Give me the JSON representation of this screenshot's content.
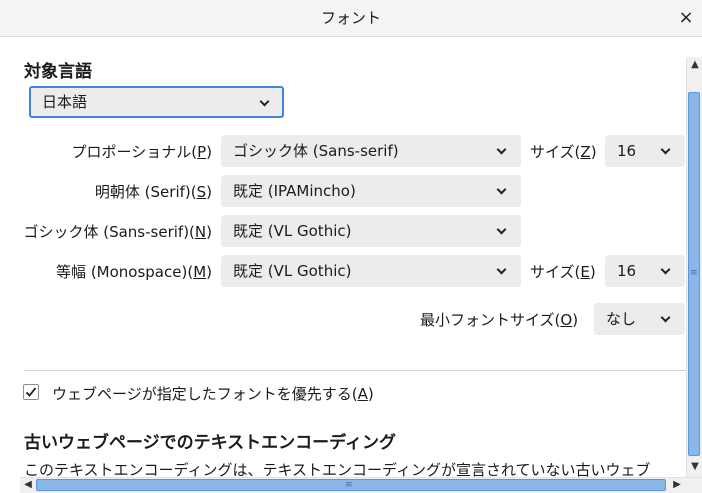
{
  "window": {
    "title": "フォント",
    "close_glyph": "×"
  },
  "language": {
    "heading": "対象言語",
    "selected": "日本語"
  },
  "rows": {
    "proportional": {
      "label_pre": "プロポーショナル(",
      "accesskey": "P",
      "label_post": ")",
      "value": "ゴシック体 (Sans-serif)",
      "size_label_pre": "サイズ(",
      "size_accesskey": "Z",
      "size_label_post": ")",
      "size_value": "16"
    },
    "serif": {
      "label_pre": "明朝体 (Serif)(",
      "accesskey": "S",
      "label_post": ")",
      "value": "既定 (IPAMincho)"
    },
    "sans": {
      "label_pre": "ゴシック体 (Sans-serif)(",
      "accesskey": "N",
      "label_post": ")",
      "value": "既定 (VL Gothic)"
    },
    "monospace": {
      "label_pre": "等幅 (Monospace)(",
      "accesskey": "M",
      "label_post": ")",
      "value": "既定 (VL Gothic)",
      "size_label_pre": "サイズ(",
      "size_accesskey": "E",
      "size_label_post": ")",
      "size_value": "16"
    },
    "minimum": {
      "label_pre": "最小フォントサイズ(",
      "accesskey": "O",
      "label_post": ")",
      "value": "なし"
    }
  },
  "allow_pages": {
    "checked": true,
    "label_pre": "ウェブページが指定したフォントを優先する(",
    "accesskey": "A",
    "label_post": ")"
  },
  "legacy": {
    "heading": "古いウェブページでのテキストエンコーディング",
    "description": "このテキストエンコーディングは、テキストエンコーディングが宣言されていない古いウェブ"
  },
  "scrollbar": {
    "up": "▲",
    "down": "▼",
    "left": "◀",
    "right": "▶",
    "grip": "≡"
  }
}
